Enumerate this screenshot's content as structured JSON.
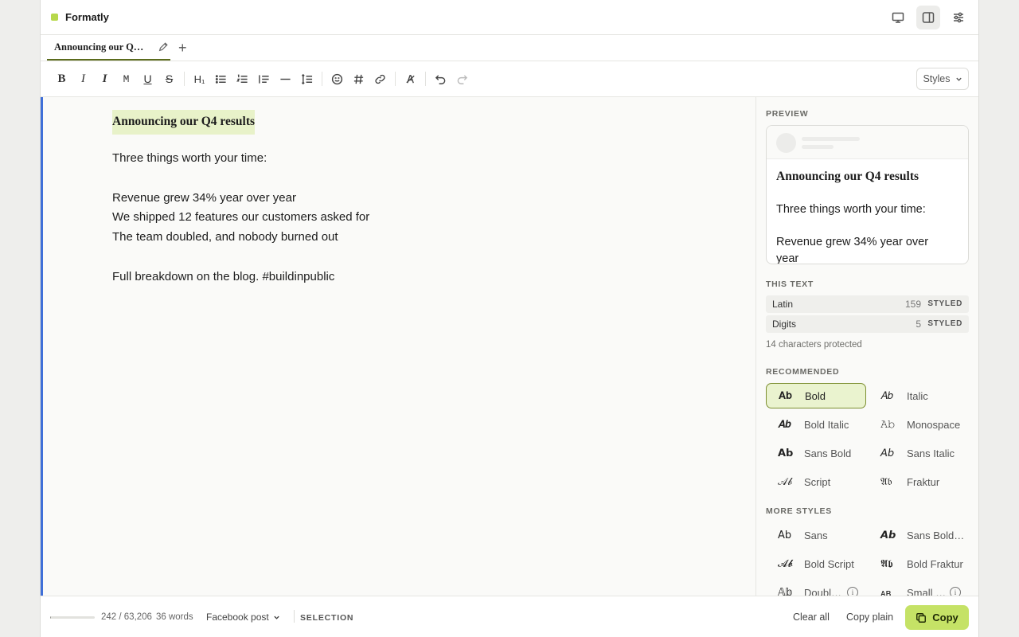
{
  "app": {
    "name": "Formatly",
    "accent": "#b7d84b"
  },
  "tab": {
    "title": "Announcing our Q…"
  },
  "toolbar": {
    "bold": "B",
    "italic": "I",
    "italic2": "I",
    "mono": "M",
    "underline": "U",
    "strike": "S",
    "heading": "H₁",
    "styles_label": "Styles"
  },
  "editor": {
    "title": "Announcing our Q4 results",
    "lines": [
      "Three things worth your time:",
      "Revenue grew 34% year over year",
      "We shipped 12 features our customers asked for",
      "The team doubled, and nobody burned out",
      "Full breakdown on the blog. #buildinpublic"
    ]
  },
  "panel": {
    "preview_heading": "PREVIEW",
    "preview": {
      "title": "Announcing our Q4 results",
      "line1": "Three things worth your time:",
      "line2a": "Revenue grew 34% year over",
      "line2b": "year"
    },
    "this_text_heading": "THIS TEXT",
    "stats": [
      {
        "label": "Latin",
        "count": "159",
        "badge": "STYLED"
      },
      {
        "label": "Digits",
        "count": "5",
        "badge": "STYLED"
      }
    ],
    "protected": "14 characters protected",
    "recommended_heading": "RECOMMENDED",
    "recommended": [
      {
        "ab": "𝐀𝐛",
        "name": "Bold"
      },
      {
        "ab": "𝐴𝑏",
        "name": "Italic"
      },
      {
        "ab": "𝑨𝒃",
        "name": "Bold Italic"
      },
      {
        "ab": "𝙰𝚋",
        "name": "Monospace"
      },
      {
        "ab": "𝗔𝗯",
        "name": "Sans Bold"
      },
      {
        "ab": "𝘈𝘣",
        "name": "Sans Italic"
      },
      {
        "ab": "𝒜𝒷",
        "name": "Script"
      },
      {
        "ab": "𝔄𝔟",
        "name": "Fraktur"
      }
    ],
    "more_heading": "MORE STYLES",
    "more": [
      {
        "ab": "𝖠𝖻",
        "name": "Sans"
      },
      {
        "ab": "𝘼𝙗",
        "name": "Sans Bold…"
      },
      {
        "ab": "𝓐𝓫",
        "name": "Bold Script"
      },
      {
        "ab": "𝕬𝖇",
        "name": "Bold Fraktur"
      },
      {
        "ab": "𝔸𝕓",
        "name": "Doubl…"
      },
      {
        "ab": "ᴀʙ",
        "name": "Small …"
      }
    ]
  },
  "footer": {
    "progress": 0.004,
    "count": "242 / 63,206",
    "words": "36 words",
    "platform": "Facebook post",
    "selection": "SELECTION",
    "clear": "Clear all",
    "copy_plain": "Copy plain",
    "copy": "Copy",
    "copy_color": "#c5e266"
  }
}
